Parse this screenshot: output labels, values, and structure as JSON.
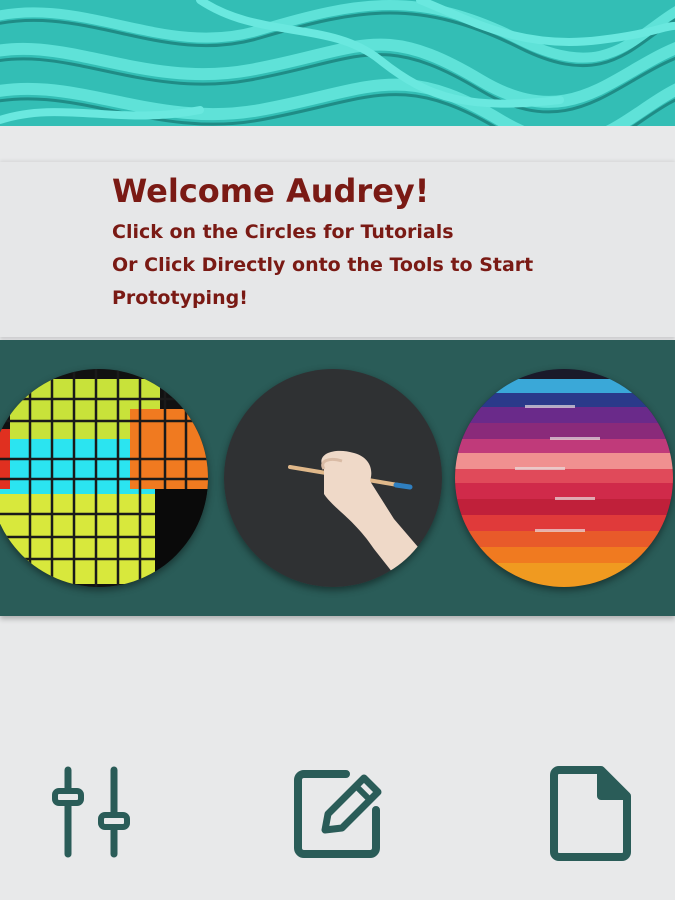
{
  "welcome": {
    "title": "Welcome Audrey!",
    "line1": "Click on the Circles for Tutorials",
    "line2": "Or Click Directly onto the Tools to Start",
    "line3": "Prototyping!"
  },
  "colors": {
    "title_text": "#7a1a14",
    "strip_background": "#2a5c58",
    "tool_icon": "#2a5c58",
    "page_background": "#e8e9ea",
    "hero_teal": "#3fc8bf"
  },
  "tutorial_circles": [
    {
      "image": "glowing-grid-cubes"
    },
    {
      "image": "hand-with-pencil"
    },
    {
      "image": "colorful-folders"
    }
  ],
  "tools": [
    {
      "icon": "sliders-icon"
    },
    {
      "icon": "edit-icon"
    },
    {
      "icon": "document-icon"
    }
  ]
}
